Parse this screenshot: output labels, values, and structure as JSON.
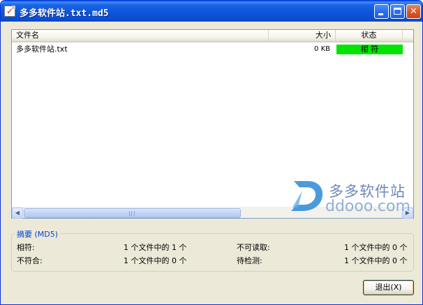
{
  "window": {
    "title": "多多软件站.txt.md5",
    "minimize_icon": "minimize-icon",
    "maximize_icon": "maximize-icon",
    "close_label": "✕"
  },
  "list": {
    "columns": {
      "name": "文件名",
      "size": "大小",
      "status": "状态"
    },
    "rows": [
      {
        "name": "多多软件站.txt",
        "size": "0 KB",
        "status": "相 符"
      }
    ],
    "status_color": "#00e400"
  },
  "watermark": {
    "cn": "多多软件站",
    "en": "ddooo.com"
  },
  "summary": {
    "title": "摘要",
    "title_suffix": "(MD5)",
    "match_label": "相符:",
    "match_value": "1 个文件中的 1 个",
    "mismatch_label": "不符合:",
    "mismatch_value": "1 个文件中的 0 个",
    "unreadable_label": "不可读取:",
    "unreadable_value": "1 个文件中的 0 个",
    "pending_label": "待检测:",
    "pending_value": "1 个文件中的 0 个"
  },
  "buttons": {
    "exit": "退出(X)"
  },
  "colors": {
    "titlebar": "#0a4fd0",
    "accent": "#0046d5",
    "ok": "#00e400"
  }
}
